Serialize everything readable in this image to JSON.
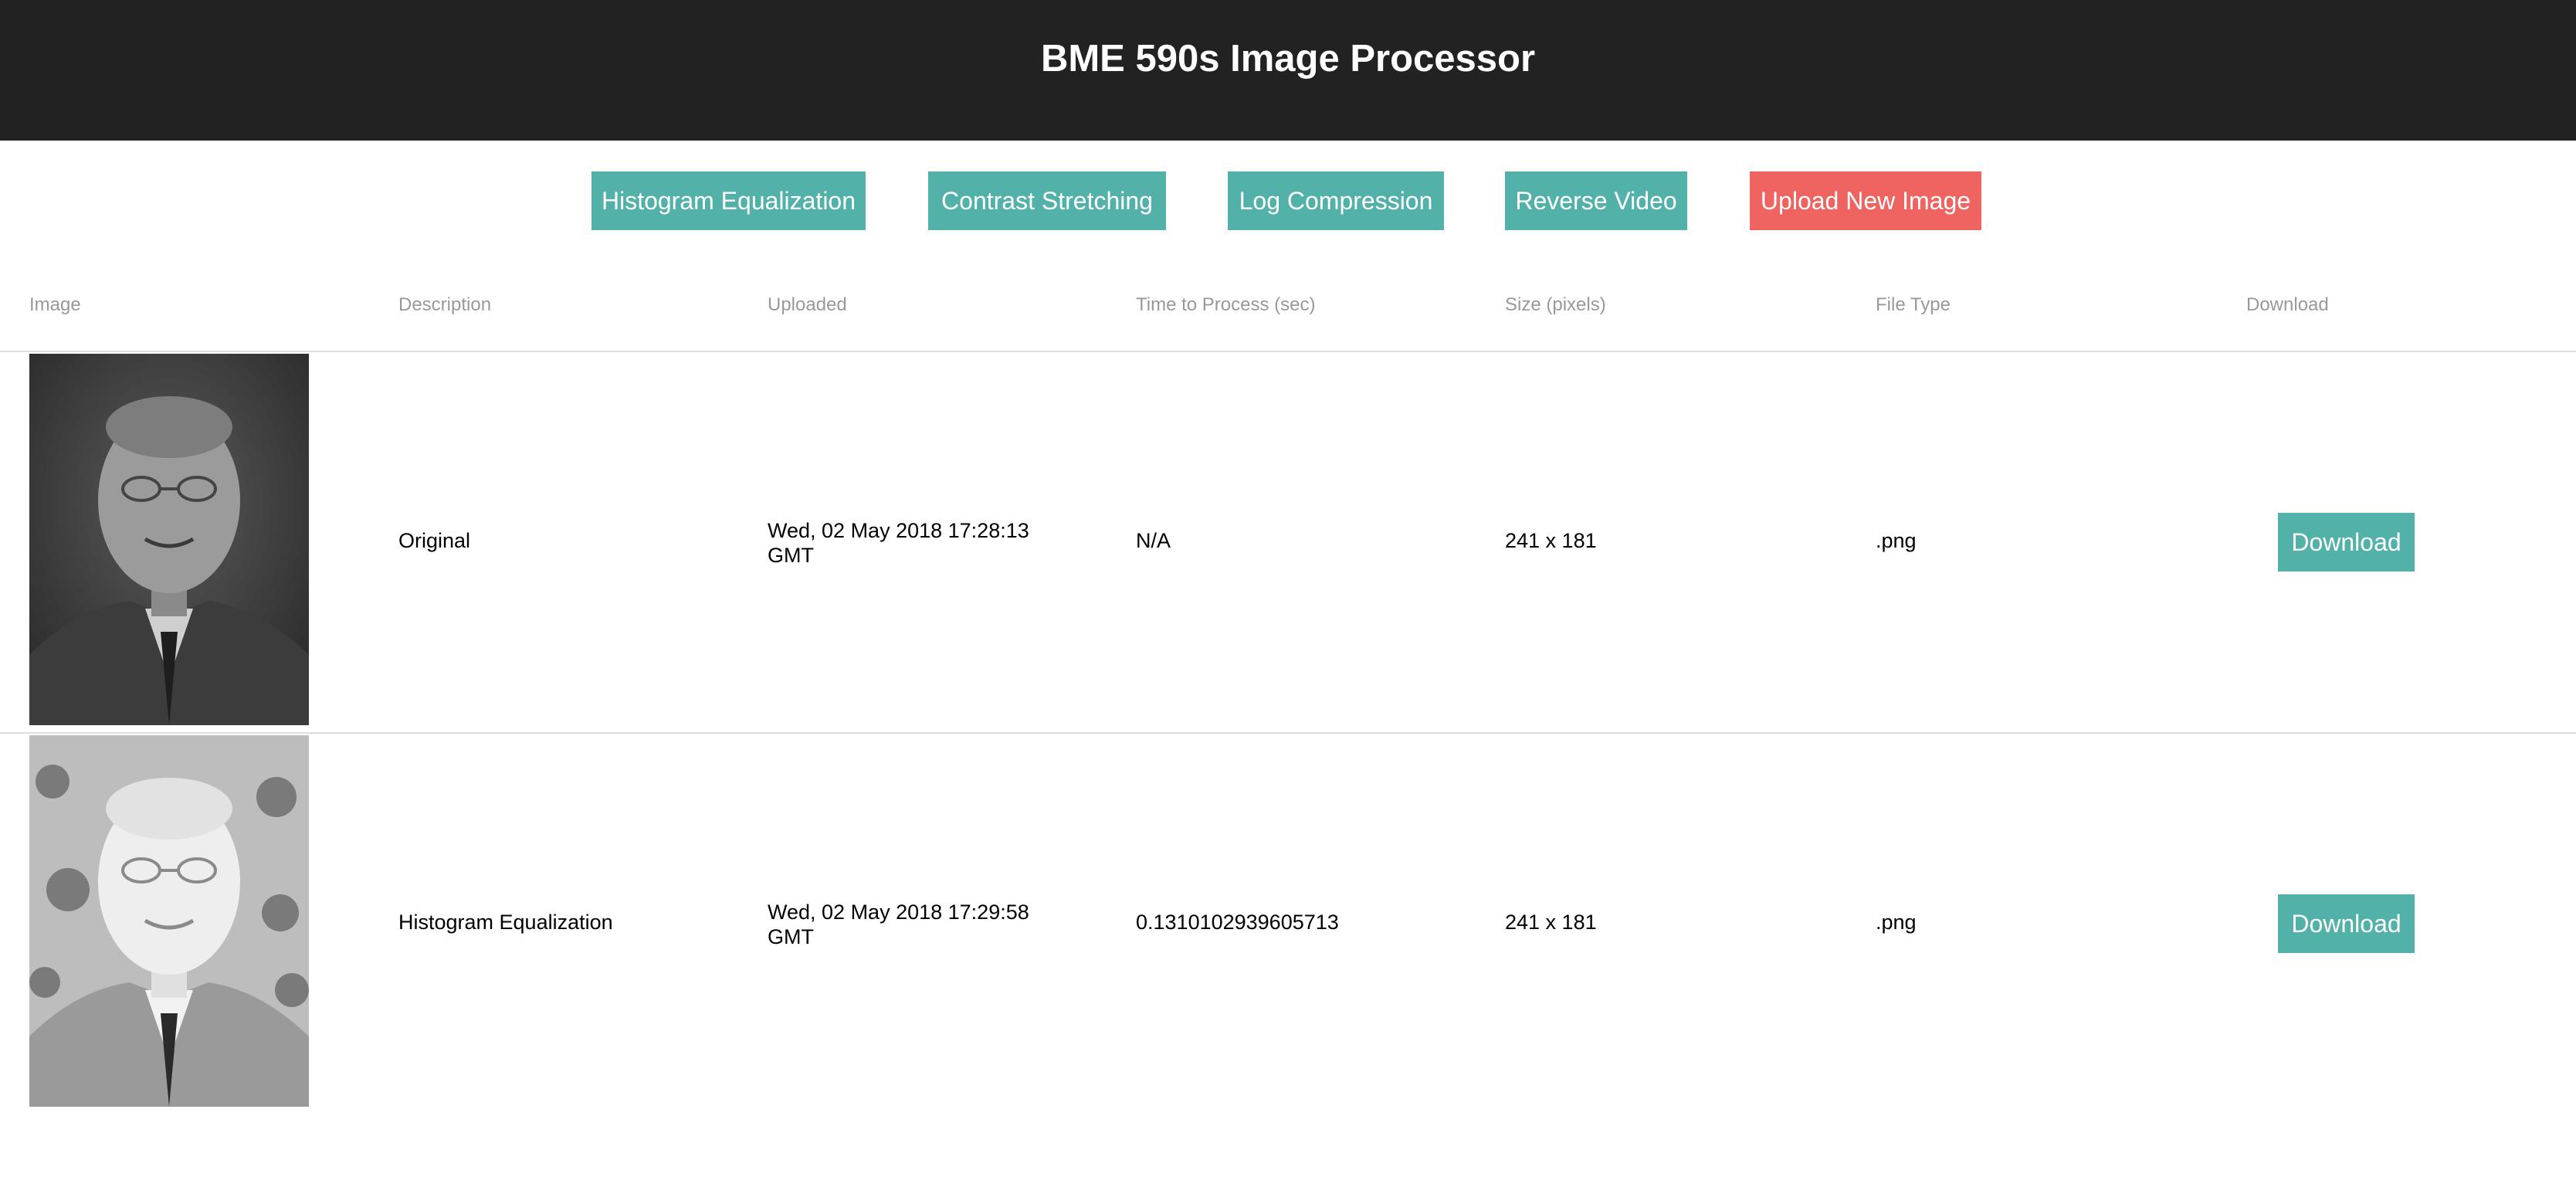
{
  "header": {
    "title": "BME 590s Image Processor"
  },
  "toolbar": {
    "buttons": [
      {
        "label": "Histogram Equalization"
      },
      {
        "label": "Contrast Stretching"
      },
      {
        "label": "Log Compression"
      },
      {
        "label": "Reverse Video"
      },
      {
        "label": "Upload New Image"
      }
    ]
  },
  "table": {
    "columns": [
      "Image",
      "Description",
      "Uploaded",
      "Time to Process (sec)",
      "Size (pixels)",
      "File Type",
      "Download"
    ],
    "rows": [
      {
        "description": "Original",
        "uploaded": "Wed, 02 May 2018 17:28:13 GMT",
        "time": "N/A",
        "size": "241 x 181",
        "filetype": ".png",
        "download_label": "Download"
      },
      {
        "description": "Histogram Equalization",
        "uploaded": "Wed, 02 May 2018 17:29:58 GMT",
        "time": "0.1310102939605713",
        "size": "241 x 181",
        "filetype": ".png",
        "download_label": "Download"
      }
    ]
  },
  "colors": {
    "header_bg": "#222222",
    "accent_teal": "#52b2aa",
    "accent_red": "#ef6461",
    "header_text_muted": "#999999"
  }
}
